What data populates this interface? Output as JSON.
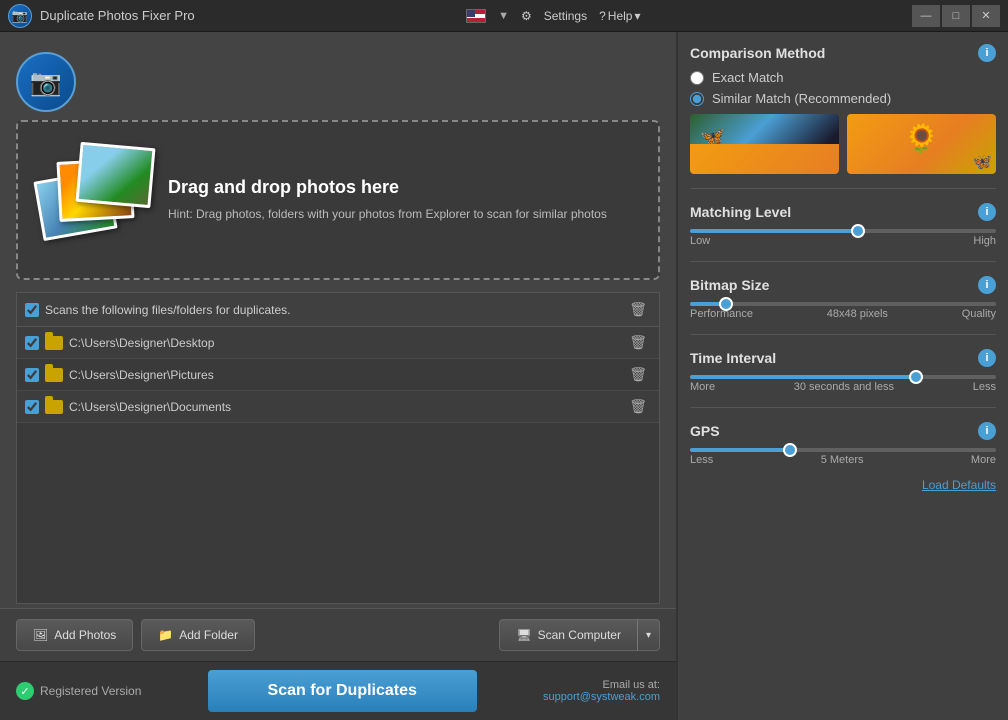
{
  "app": {
    "title": "Duplicate Photos Fixer Pro",
    "menu": {
      "settings": "Settings",
      "help": "Help"
    }
  },
  "titlebar": {
    "minimize": "—",
    "maximize": "□",
    "close": "✕"
  },
  "drop_zone": {
    "title": "Drag and drop photos here",
    "hint": "Hint: Drag photos, folders with your photos from Explorer to scan for similar photos"
  },
  "file_list": {
    "header": "Scans the following files/folders for duplicates.",
    "files": [
      {
        "path": "C:\\Users\\Designer\\Desktop"
      },
      {
        "path": "C:\\Users\\Designer\\Pictures"
      },
      {
        "path": "C:\\Users\\Designer\\Documents"
      }
    ]
  },
  "buttons": {
    "add_photos": "Add Photos",
    "add_folder": "Add Folder",
    "scan_computer": "Scan Computer",
    "scan_duplicates": "Scan for Duplicates"
  },
  "status": {
    "registered": "Registered Version",
    "email_label": "Email us at:",
    "email": "support@systweak.com"
  },
  "right_panel": {
    "comparison_method": {
      "title": "Comparison Method",
      "options": [
        {
          "label": "Exact Match",
          "checked": false
        },
        {
          "label": "Similar Match (Recommended)",
          "checked": true
        }
      ]
    },
    "matching_level": {
      "title": "Matching Level",
      "value": 55,
      "min_label": "Low",
      "max_label": "High"
    },
    "bitmap_size": {
      "title": "Bitmap Size",
      "value": 10,
      "value_label": "48x48 pixels",
      "min_label": "Performance",
      "max_label": "Quality"
    },
    "time_interval": {
      "title": "Time Interval",
      "value": 75,
      "value_label": "30 seconds and less",
      "min_label": "More",
      "max_label": "Less"
    },
    "gps": {
      "title": "GPS",
      "value": 32,
      "value_label": "5 Meters",
      "min_label": "Less",
      "max_label": "More"
    },
    "load_defaults": "Load Defaults"
  }
}
